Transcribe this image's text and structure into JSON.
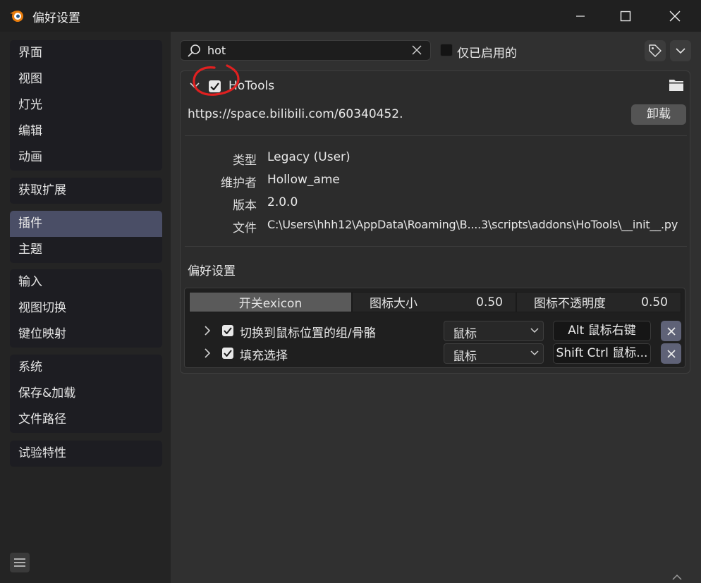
{
  "window": {
    "title": "偏好设置"
  },
  "sidebar": {
    "groups": [
      {
        "items": [
          {
            "label": "界面"
          },
          {
            "label": "视图"
          },
          {
            "label": "灯光"
          },
          {
            "label": "编辑"
          },
          {
            "label": "动画"
          }
        ]
      },
      {
        "items": [
          {
            "label": "获取扩展"
          }
        ]
      },
      {
        "items": [
          {
            "label": "插件",
            "active": true
          },
          {
            "label": "主题"
          }
        ]
      },
      {
        "items": [
          {
            "label": "输入"
          },
          {
            "label": "视图切换"
          },
          {
            "label": "键位映射"
          }
        ]
      },
      {
        "items": [
          {
            "label": "系统"
          },
          {
            "label": "保存&加载"
          },
          {
            "label": "文件路径"
          }
        ]
      },
      {
        "items": [
          {
            "label": "试验特性"
          }
        ]
      }
    ]
  },
  "search": {
    "value": "hot"
  },
  "filter": {
    "enabled_only_label": "仅已启用的",
    "checked": false
  },
  "addon": {
    "name": "HoTools",
    "enabled": true,
    "url": "https://space.bilibili.com/60340452.",
    "uninstall_label": "卸载",
    "info": [
      {
        "label": "类型",
        "value": "Legacy (User)"
      },
      {
        "label": "维护者",
        "value": "Hollow_ame"
      },
      {
        "label": "版本",
        "value": "2.0.0"
      },
      {
        "label": "文件",
        "value": "C:\\Users\\hhh12\\AppData\\Roaming\\B....3\\scripts\\addons\\HoTools\\__init__.py"
      }
    ],
    "prefs_title": "偏好设置",
    "tabs": [
      {
        "label": "开关exicon",
        "active": true
      },
      {
        "label": "图标大小",
        "value": "0.50"
      },
      {
        "label": "图标不透明度",
        "value": "0.50"
      }
    ],
    "keymaps": [
      {
        "label": "切换到鼠标位置的组/骨骼",
        "enabled": true,
        "device": "鼠标",
        "key": "Alt 鼠标右键"
      },
      {
        "label": "填充选择",
        "enabled": true,
        "device": "鼠标",
        "key": "Shift Ctrl 鼠标..."
      }
    ]
  },
  "colors": {
    "accent": "#4a4e66",
    "annotation": "#e02020"
  }
}
